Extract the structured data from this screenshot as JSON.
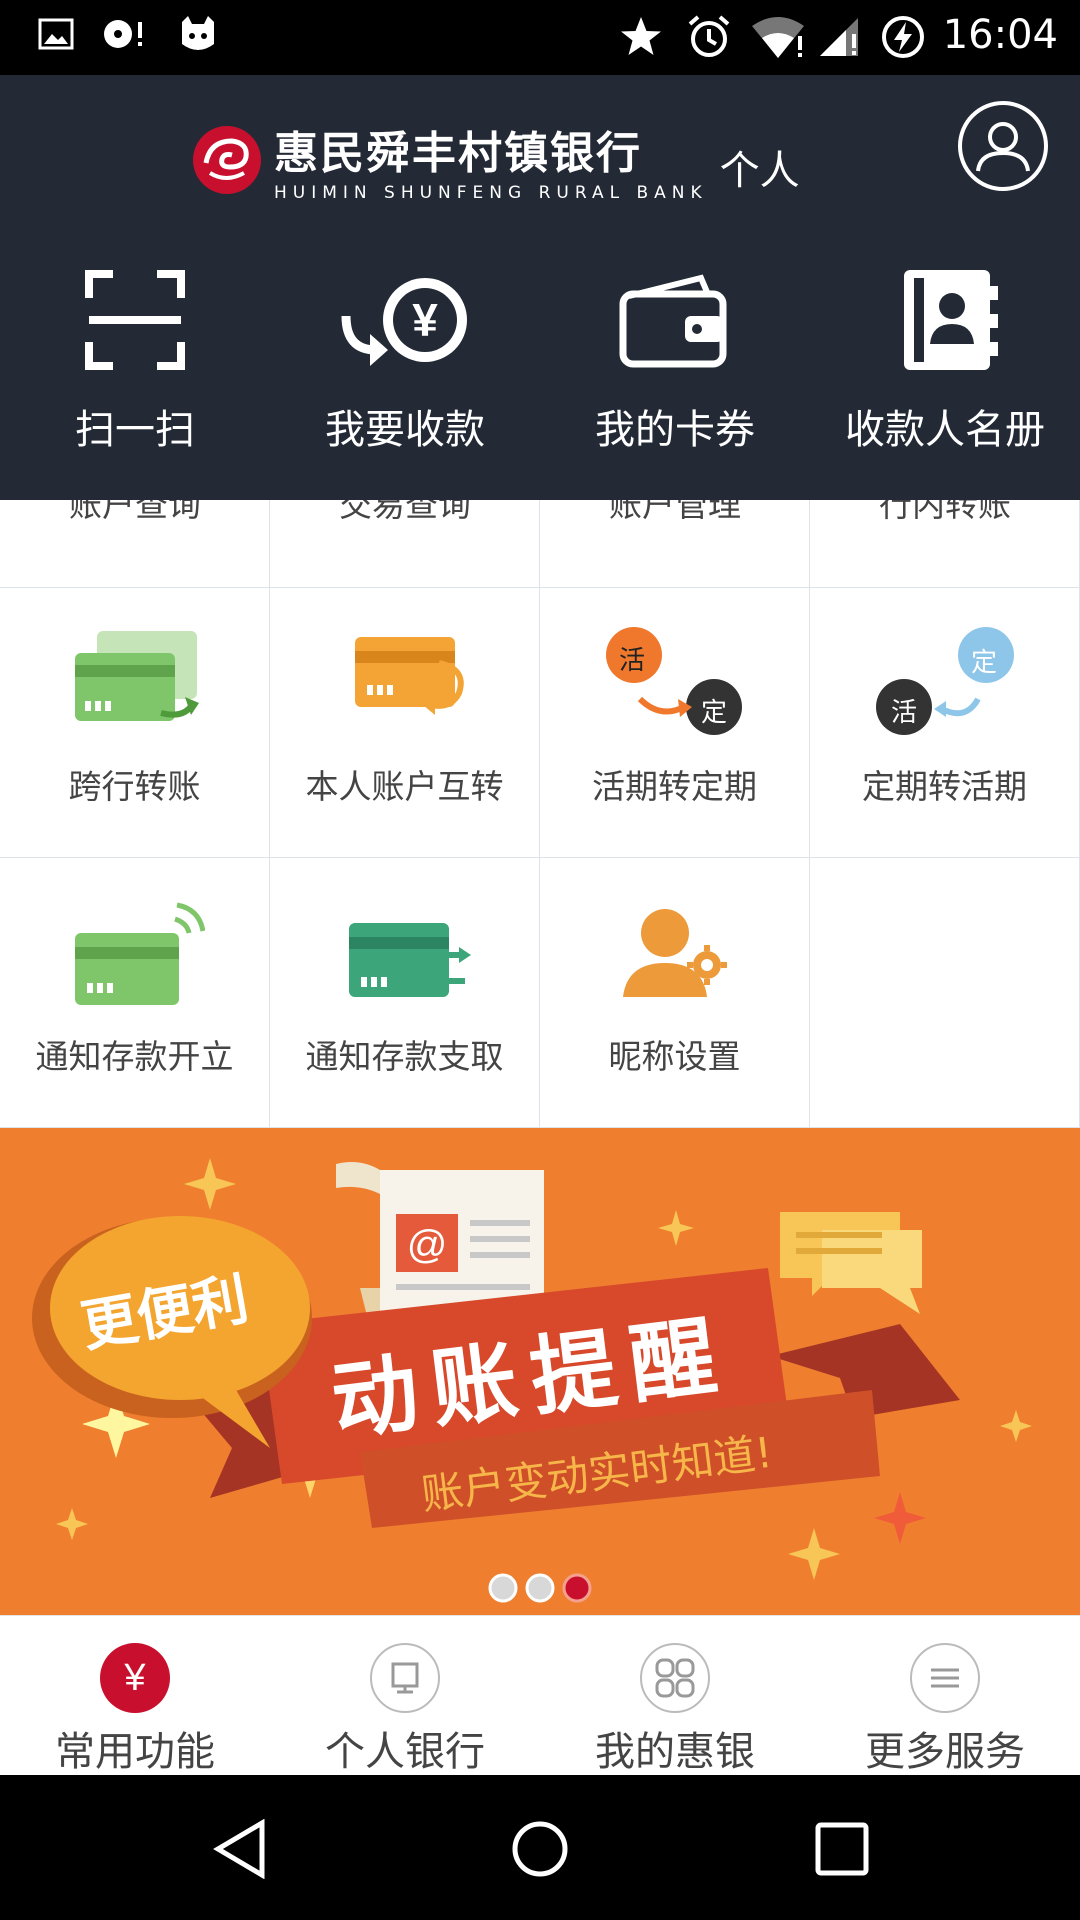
{
  "status_bar": {
    "time": "16:04"
  },
  "header": {
    "bank_name": "惠民舜丰村镇银行",
    "bank_name_en": "HUIMIN SHUNFENG RURAL BANK",
    "section": "个人"
  },
  "quick_actions": [
    {
      "label": "扫一扫",
      "icon": "scan-icon"
    },
    {
      "label": "我要收款",
      "icon": "receive-money-icon"
    },
    {
      "label": "我的卡券",
      "icon": "wallet-icon"
    },
    {
      "label": "收款人名册",
      "icon": "payee-book-icon"
    }
  ],
  "menu_cut_off": [
    "账户查询",
    "交易查询",
    "账户管理",
    "行内转账"
  ],
  "menu": [
    {
      "label": "跨行转账",
      "icon": "interbank-transfer-icon"
    },
    {
      "label": "本人账户互转",
      "icon": "own-account-transfer-icon"
    },
    {
      "label": "活期转定期",
      "icon": "current-to-fixed-icon",
      "badge_a": "活",
      "badge_b": "定"
    },
    {
      "label": "定期转活期",
      "icon": "fixed-to-current-icon",
      "badge_a": "定",
      "badge_b": "活"
    },
    {
      "label": "通知存款开立",
      "icon": "notice-deposit-open-icon"
    },
    {
      "label": "通知存款支取",
      "icon": "notice-deposit-withdraw-icon"
    },
    {
      "label": "昵称设置",
      "icon": "nickname-settings-icon"
    }
  ],
  "banner": {
    "tag": "更便利",
    "headline": "动账提醒",
    "subline": "账户变动实时知道!",
    "dots": 3,
    "active_dot": 3
  },
  "bottom_nav": [
    {
      "label": "常用功能",
      "icon": "yuan-icon",
      "active": true
    },
    {
      "label": "个人银行",
      "icon": "personal-bank-icon",
      "active": false
    },
    {
      "label": "我的惠银",
      "icon": "my-huiyin-icon",
      "active": false
    },
    {
      "label": "更多服务",
      "icon": "more-services-icon",
      "active": false
    }
  ],
  "colors": {
    "header_bg": "#232a36",
    "accent_red": "#c8102e",
    "banner_bg": "#ef7f2f"
  }
}
